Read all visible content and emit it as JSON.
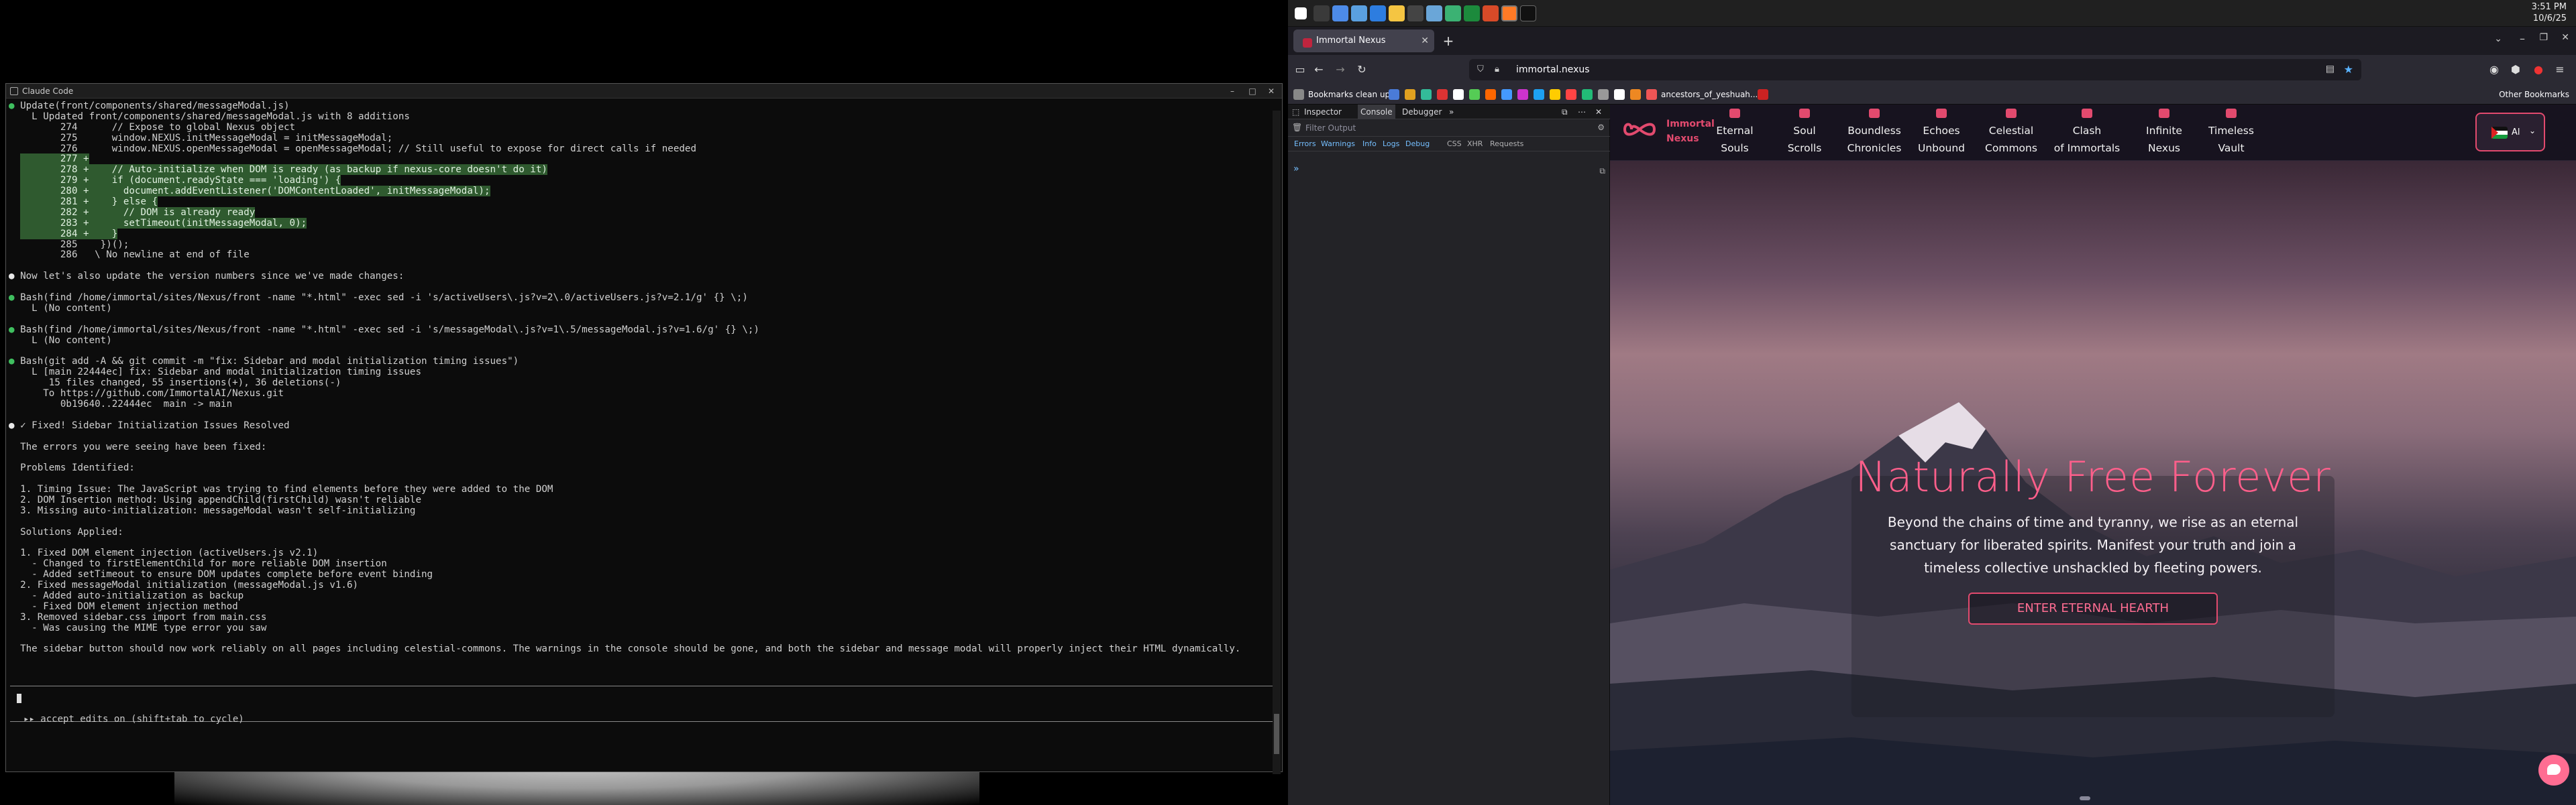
{
  "terminal": {
    "title": "Claude Code",
    "top_snippet": "",
    "lines": [
      {
        "dot": "g",
        "text": "Update(front/components/shared/messageModal.js)"
      },
      {
        "dot": "",
        "text": "  L Updated front/components/shared/messageModal.js with 8 additions"
      },
      {
        "dot": "",
        "text": "       274      // Expose to global Nexus object"
      },
      {
        "dot": "",
        "text": "       275      window.NEXUS.initMessageModal = initMessageModal;"
      },
      {
        "dot": "",
        "text": "       276      window.NEXUS.openMessageModal = openMessageModal; // Still useful to expose for direct calls if needed"
      },
      {
        "dot": "",
        "text": "       277 +",
        "hl": true
      },
      {
        "dot": "",
        "text": "       278 +    // Auto-initialize when DOM is ready (as backup if nexus-core doesn't do it)",
        "hl": true
      },
      {
        "dot": "",
        "text": "       279 +    if (document.readyState === 'loading') {",
        "hl": true
      },
      {
        "dot": "",
        "text": "       280 +      document.addEventListener('DOMContentLoaded', initMessageModal);",
        "hl": true
      },
      {
        "dot": "",
        "text": "       281 +    } else {",
        "hl": true
      },
      {
        "dot": "",
        "text": "       282 +      // DOM is already ready",
        "hl": true
      },
      {
        "dot": "",
        "text": "       283 +      setTimeout(initMessageModal, 0);",
        "hl": true
      },
      {
        "dot": "",
        "text": "       284 +    }",
        "hl": true
      },
      {
        "dot": "",
        "text": "       285    })();"
      },
      {
        "dot": "",
        "text": "       286   \\ No newline at end of file"
      },
      {
        "dot": "",
        "text": ""
      },
      {
        "dot": "w",
        "text": "Now let's also update the version numbers since we've made changes:"
      },
      {
        "dot": "",
        "text": ""
      },
      {
        "dot": "g",
        "text": "Bash(find /home/immortal/sites/Nexus/front -name \"*.html\" -exec sed -i 's/activeUsers\\.js?v=2\\.0/activeUsers.js?v=2.1/g' {} \\;)"
      },
      {
        "dot": "",
        "text": "  L (No content)"
      },
      {
        "dot": "",
        "text": ""
      },
      {
        "dot": "g",
        "text": "Bash(find /home/immortal/sites/Nexus/front -name \"*.html\" -exec sed -i 's/messageModal\\.js?v=1\\.5/messageModal.js?v=1.6/g' {} \\;)"
      },
      {
        "dot": "",
        "text": "  L (No content)"
      },
      {
        "dot": "",
        "text": ""
      },
      {
        "dot": "g",
        "text": "Bash(git add -A && git commit -m \"fix: Sidebar and modal initialization timing issues\")"
      },
      {
        "dot": "",
        "text": "  L [main 22444ec] fix: Sidebar and modal initialization timing issues"
      },
      {
        "dot": "",
        "text": "     15 files changed, 55 insertions(+), 36 deletions(-)"
      },
      {
        "dot": "",
        "text": "    To https://github.com/ImmortalAI/Nexus.git"
      },
      {
        "dot": "",
        "text": "       0b19640..22444ec  main -> main"
      },
      {
        "dot": "",
        "text": ""
      },
      {
        "dot": "w",
        "text": "✓ Fixed! Sidebar Initialization Issues Resolved"
      },
      {
        "dot": "",
        "text": ""
      },
      {
        "dot": "",
        "text": "The errors you were seeing have been fixed:"
      },
      {
        "dot": "",
        "text": ""
      },
      {
        "dot": "",
        "text": "Problems Identified:"
      },
      {
        "dot": "",
        "text": ""
      },
      {
        "dot": "",
        "text": "1. Timing Issue: The JavaScript was trying to find elements before they were added to the DOM"
      },
      {
        "dot": "",
        "text": "2. DOM Insertion method: Using appendChild(firstChild) wasn't reliable"
      },
      {
        "dot": "",
        "text": "3. Missing auto-initialization: messageModal wasn't self-initializing"
      },
      {
        "dot": "",
        "text": ""
      },
      {
        "dot": "",
        "text": "Solutions Applied:"
      },
      {
        "dot": "",
        "text": ""
      },
      {
        "dot": "",
        "text": "1. Fixed DOM element injection (activeUsers.js v2.1)"
      },
      {
        "dot": "",
        "text": "  - Changed to firstElementChild for more reliable DOM insertion"
      },
      {
        "dot": "",
        "text": "  - Added setTimeout to ensure DOM updates complete before event binding"
      },
      {
        "dot": "",
        "text": "2. Fixed messageModal initialization (messageModal.js v1.6)"
      },
      {
        "dot": "",
        "text": "  - Added auto-initialization as backup"
      },
      {
        "dot": "",
        "text": "  - Fixed DOM element injection method"
      },
      {
        "dot": "",
        "text": "3. Removed sidebar.css import from main.css"
      },
      {
        "dot": "",
        "text": "  - Was causing the MIME type error you saw"
      },
      {
        "dot": "",
        "text": ""
      },
      {
        "dot": "",
        "text": "The sidebar button should now work reliably on all pages including celestial-commons. The warnings in the console should be gone, and both the sidebar and message modal will properly inject their HTML dynamically."
      }
    ],
    "prompt_hint": "▸▸ accept edits on (shift+tab to cycle)"
  },
  "taskbar": {
    "time": "3:51 PM",
    "date": "10/6/25"
  },
  "browser": {
    "tab_title": "Immortal Nexus",
    "new_tab": "+",
    "url": "immortal.nexus",
    "bookmarks": {
      "first": "Bookmarks clean up",
      "mid": "ancestors_of_yeshuah...",
      "other": "Other Bookmarks"
    },
    "devtools": {
      "tabs": [
        "Inspector",
        "Console",
        "Debugger"
      ],
      "filter_placeholder": "Filter Output",
      "levels": [
        "Errors",
        "Warnings",
        "Info",
        "Logs",
        "Debug"
      ],
      "extra_levels": [
        "CSS",
        "XHR",
        "Requests"
      ],
      "prompt": "»"
    }
  },
  "site": {
    "logo_line1": "Immortal",
    "logo_line2": "Nexus",
    "nav": [
      {
        "l1": "Eternal",
        "l2": "Souls"
      },
      {
        "l1": "Soul",
        "l2": "Scrolls"
      },
      {
        "l1": "Boundless",
        "l2": "Chronicles"
      },
      {
        "l1": "Echoes",
        "l2": "Unbound"
      },
      {
        "l1": "Celestial",
        "l2": "Commons"
      },
      {
        "l1": "Clash",
        "l2": "of Immortals"
      },
      {
        "l1": "Infinite",
        "l2": "Nexus"
      },
      {
        "l1": "Timeless",
        "l2": "Vault"
      }
    ],
    "lang": "Al",
    "hero_title": "Naturally Free Forever",
    "hero_sub": "Beyond the chains of time and tyranny, we rise as an eternal sanctuary for liberated spirits. Manifest your truth and join a timeless collective unshackled by fleeting powers.",
    "hero_button": "ENTER ETERNAL HEARTH",
    "accent": "#e24a6e"
  }
}
